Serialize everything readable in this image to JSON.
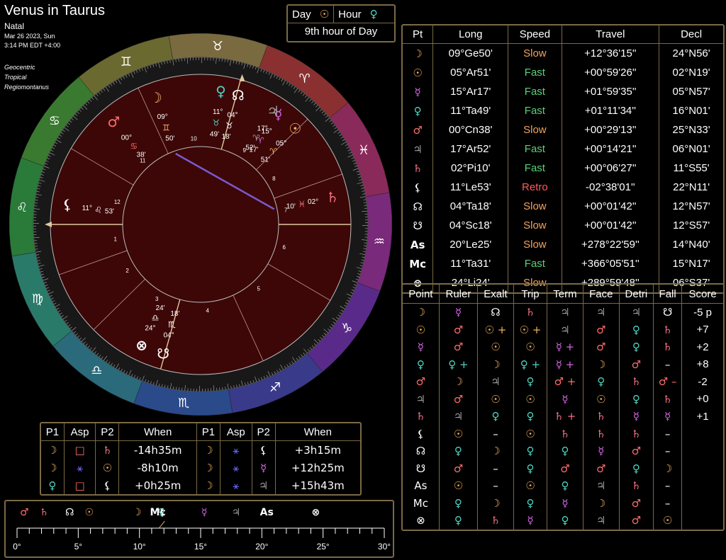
{
  "header": {
    "title": "Venus in Taurus",
    "subtitle": "Natal",
    "date": "Mar 26 2023, Sun",
    "time": "3:14 PM EDT +4:00",
    "settings": [
      "Geocentric",
      "Tropical",
      "Regiomontanus"
    ]
  },
  "day_hour": {
    "day_label": "Day",
    "day_symbol": "☉",
    "hour_label": "Hour",
    "hour_symbol": "♀",
    "hour_text": "9th hour of Day"
  },
  "colors": {
    "border": "#7a6a45",
    "wheel_fill": "#3d0707",
    "moon": "#f0b060",
    "sun": "#f0b060",
    "mercury": "#d667e6",
    "venus": "#4fd4c0",
    "mars": "#ff6d6d",
    "jupiter": "#9a9a9a",
    "saturn": "#f07080",
    "white": "#ffffff",
    "slow": "#f5a25a",
    "fast": "#5bd17a",
    "retro": "#ff5a5a"
  },
  "positions": {
    "headers": [
      "Pt",
      "Long",
      "Speed",
      "Travel",
      "Decl"
    ],
    "rows": [
      {
        "sym": "☽",
        "color": "#f0b060",
        "long": "09°Ge50'",
        "speed": "Slow",
        "travel": "+12°36'15''",
        "decl": "24°N56'"
      },
      {
        "sym": "☉",
        "color": "#f0b060",
        "long": "05°Ar51'",
        "speed": "Fast",
        "travel": "+00°59'26''",
        "decl": "02°N19'"
      },
      {
        "sym": "☿",
        "color": "#d667e6",
        "long": "15°Ar17'",
        "speed": "Fast",
        "travel": "+01°59'35''",
        "decl": "05°N57'"
      },
      {
        "sym": "♀",
        "color": "#4fd4c0",
        "long": "11°Ta49'",
        "speed": "Fast",
        "travel": "+01°11'34''",
        "decl": "16°N01'"
      },
      {
        "sym": "♂",
        "color": "#ff6d6d",
        "long": "00°Cn38'",
        "speed": "Slow",
        "travel": "+00°29'13''",
        "decl": "25°N33'"
      },
      {
        "sym": "♃",
        "color": "#9a9a9a",
        "long": "17°Ar52'",
        "speed": "Fast",
        "travel": "+00°14'21''",
        "decl": "06°N01'"
      },
      {
        "sym": "♄",
        "color": "#f07080",
        "long": "02°Pi10'",
        "speed": "Fast",
        "travel": "+00°06'27''",
        "decl": "11°S55'"
      },
      {
        "sym": "⚸",
        "color": "#ffffff",
        "long": "11°Le53'",
        "speed": "Retro",
        "travel": "-02°38'01''",
        "decl": "22°N11'"
      },
      {
        "sym": "☊",
        "color": "#ffffff",
        "long": "04°Ta18'",
        "speed": "Slow",
        "travel": "+00°01'42''",
        "decl": "12°N57'"
      },
      {
        "sym": "☋",
        "color": "#ffffff",
        "long": "04°Sc18'",
        "speed": "Slow",
        "travel": "+00°01'42''",
        "decl": "12°S57'"
      },
      {
        "sym": "As",
        "color": "#ffffff",
        "long": "20°Le25'",
        "speed": "Slow",
        "travel": "+278°22'59''",
        "decl": "14°N40'"
      },
      {
        "sym": "Mc",
        "color": "#ffffff",
        "long": "11°Ta31'",
        "speed": "Fast",
        "travel": "+366°05'51''",
        "decl": "15°N17'"
      },
      {
        "sym": "⊗",
        "color": "#ffffff",
        "long": "24°Li24'",
        "speed": "Slow",
        "travel": "+289°59'48''",
        "decl": "06°S37'"
      }
    ]
  },
  "dignities": {
    "headers": [
      "Point",
      "Ruler",
      "Exalt",
      "Trip",
      "Term",
      "Face",
      "Detri",
      "Fall",
      "Score"
    ],
    "rows": [
      {
        "cells": [
          "☽",
          "☿",
          "☊",
          "♄",
          "♃",
          "♃",
          "♃",
          "☋"
        ],
        "colors": [
          "#f0b060",
          "#d667e6",
          "#fff",
          "#f07080",
          "#9a9a9a",
          "#9a9a9a",
          "#9a9a9a",
          "#fff"
        ],
        "score": "-5 p"
      },
      {
        "cells": [
          "☉",
          "♂",
          "☉ +",
          "☉ +",
          "♃",
          "♂",
          "♀",
          "♄"
        ],
        "colors": [
          "#f0b060",
          "#ff6d6d",
          "#f0b060",
          "#f0b060",
          "#9a9a9a",
          "#ff6d6d",
          "#4fd4c0",
          "#f07080"
        ],
        "score": "+7"
      },
      {
        "cells": [
          "☿",
          "♂",
          "☉",
          "☉",
          "☿ +",
          "♂",
          "♀",
          "♄"
        ],
        "colors": [
          "#d667e6",
          "#ff6d6d",
          "#f0b060",
          "#f0b060",
          "#d667e6",
          "#ff6d6d",
          "#4fd4c0",
          "#f07080"
        ],
        "score": "+2"
      },
      {
        "cells": [
          "♀",
          "♀ +",
          "☽",
          "♀ +",
          "☿ +",
          "☽",
          "♂",
          "–"
        ],
        "colors": [
          "#4fd4c0",
          "#4fd4c0",
          "#f0b060",
          "#4fd4c0",
          "#d667e6",
          "#f0b060",
          "#ff6d6d",
          "#fff"
        ],
        "score": "+8"
      },
      {
        "cells": [
          "♂",
          "☽",
          "♃",
          "♀",
          "♂ +",
          "♀",
          "♄",
          "♂ –"
        ],
        "colors": [
          "#ff6d6d",
          "#f0b060",
          "#9a9a9a",
          "#4fd4c0",
          "#ff6d6d",
          "#4fd4c0",
          "#f07080",
          "#ff6d6d"
        ],
        "score": "-2"
      },
      {
        "cells": [
          "♃",
          "♂",
          "☉",
          "☉",
          "☿",
          "☉",
          "♀",
          "♄"
        ],
        "colors": [
          "#9a9a9a",
          "#ff6d6d",
          "#f0b060",
          "#f0b060",
          "#d667e6",
          "#f0b060",
          "#4fd4c0",
          "#f07080"
        ],
        "score": "+0"
      },
      {
        "cells": [
          "♄",
          "♃",
          "♀",
          "♀",
          "♄ +",
          "♄",
          "☿",
          "☿"
        ],
        "colors": [
          "#f07080",
          "#9a9a9a",
          "#4fd4c0",
          "#4fd4c0",
          "#f07080",
          "#f07080",
          "#d667e6",
          "#d667e6"
        ],
        "score": "+1"
      },
      {
        "cells": [
          "⚸",
          "☉",
          "–",
          "☉",
          "♄",
          "♄",
          "♄",
          "–"
        ],
        "colors": [
          "#fff",
          "#f0b060",
          "#fff",
          "#f0b060",
          "#f07080",
          "#f07080",
          "#f07080",
          "#fff"
        ],
        "score": ""
      },
      {
        "cells": [
          "☊",
          "♀",
          "☽",
          "♀",
          "♀",
          "☿",
          "♂",
          "–"
        ],
        "colors": [
          "#fff",
          "#4fd4c0",
          "#f0b060",
          "#4fd4c0",
          "#4fd4c0",
          "#d667e6",
          "#ff6d6d",
          "#fff"
        ],
        "score": ""
      },
      {
        "cells": [
          "☋",
          "♂",
          "–",
          "♀",
          "♂",
          "♂",
          "♀",
          "☽"
        ],
        "colors": [
          "#fff",
          "#ff6d6d",
          "#fff",
          "#4fd4c0",
          "#ff6d6d",
          "#ff6d6d",
          "#4fd4c0",
          "#f0b060"
        ],
        "score": ""
      },
      {
        "cells": [
          "As",
          "☉",
          "–",
          "☉",
          "♀",
          "♃",
          "♄",
          "–"
        ],
        "colors": [
          "#fff",
          "#f0b060",
          "#fff",
          "#f0b060",
          "#4fd4c0",
          "#9a9a9a",
          "#f07080",
          "#fff"
        ],
        "score": ""
      },
      {
        "cells": [
          "Mc",
          "♀",
          "☽",
          "♀",
          "☿",
          "☽",
          "♂",
          "–"
        ],
        "colors": [
          "#fff",
          "#4fd4c0",
          "#f0b060",
          "#4fd4c0",
          "#d667e6",
          "#f0b060",
          "#ff6d6d",
          "#fff"
        ],
        "score": ""
      },
      {
        "cells": [
          "⊗",
          "♀",
          "♄",
          "☿",
          "♀",
          "♃",
          "♂",
          "☉"
        ],
        "colors": [
          "#fff",
          "#4fd4c0",
          "#f07080",
          "#d667e6",
          "#4fd4c0",
          "#9a9a9a",
          "#ff6d6d",
          "#f0b060"
        ],
        "score": ""
      }
    ]
  },
  "aspects": {
    "headers": [
      "P1",
      "Asp",
      "P2",
      "When",
      "P1",
      "Asp",
      "P2",
      "When"
    ],
    "rows": [
      [
        {
          "s": "☽",
          "c": "#f0b060"
        },
        {
          "s": "□",
          "c": "#ff6d6d"
        },
        {
          "s": "♄",
          "c": "#f07080"
        },
        {
          "s": "-14h35m",
          "c": "#fff"
        },
        {
          "s": "☽",
          "c": "#f0b060"
        },
        {
          "s": "⚹",
          "c": "#6a6aff"
        },
        {
          "s": "⚸",
          "c": "#fff"
        },
        {
          "s": "+3h15m",
          "c": "#fff"
        }
      ],
      [
        {
          "s": "☽",
          "c": "#f0b060"
        },
        {
          "s": "⚹",
          "c": "#6a6aff"
        },
        {
          "s": "☉",
          "c": "#f0b060"
        },
        {
          "s": "-8h10m",
          "c": "#fff"
        },
        {
          "s": "☽",
          "c": "#f0b060"
        },
        {
          "s": "⚹",
          "c": "#6a6aff"
        },
        {
          "s": "☿",
          "c": "#d667e6"
        },
        {
          "s": "+12h25m",
          "c": "#fff"
        }
      ],
      [
        {
          "s": "♀",
          "c": "#4fd4c0"
        },
        {
          "s": "□",
          "c": "#ff6d6d"
        },
        {
          "s": "⚸",
          "c": "#fff"
        },
        {
          "s": "+0h25m",
          "c": "#fff"
        },
        {
          "s": "☽",
          "c": "#f0b060"
        },
        {
          "s": "⚹",
          "c": "#6a6aff"
        },
        {
          "s": "♃",
          "c": "#9a9a9a"
        },
        {
          "s": "+15h43m",
          "c": "#fff"
        }
      ]
    ]
  },
  "ruler": {
    "tick_labels": [
      "0°",
      "5°",
      "10°",
      "15°",
      "20°",
      "25°",
      "30°"
    ],
    "markers": [
      {
        "sym": "♂",
        "deg": 0.6,
        "color": "#ff6d6d"
      },
      {
        "sym": "♄",
        "deg": 2.2,
        "color": "#f07080"
      },
      {
        "sym": "☊",
        "deg": 4.3,
        "color": "#fff"
      },
      {
        "sym": "☉",
        "deg": 5.9,
        "color": "#f0b060"
      },
      {
        "sym": "☽",
        "deg": 9.8,
        "color": "#f0b060"
      },
      {
        "sym": "Mc",
        "deg": 11.5,
        "color": "#fff"
      },
      {
        "sym": "♀",
        "deg": 11.8,
        "color": "#4fd4c0"
      },
      {
        "sym": "⚸",
        "deg": 11.9,
        "color": "#fff"
      },
      {
        "sym": "☿",
        "deg": 15.3,
        "color": "#d667e6"
      },
      {
        "sym": "♃",
        "deg": 17.9,
        "color": "#9a9a9a"
      },
      {
        "sym": "As",
        "deg": 20.4,
        "color": "#fff"
      },
      {
        "sym": "⊗",
        "deg": 24.4,
        "color": "#fff"
      }
    ]
  },
  "wheel": {
    "asc_deg": 140.42,
    "signs": [
      "♈",
      "♉",
      "♊",
      "♋",
      "♌",
      "♍",
      "♎",
      "♏",
      "♐",
      "♑",
      "♒",
      "♓"
    ],
    "sign_colors": [
      "#8a3030",
      "#7a6a40",
      "#6a6a30",
      "#3a7a30",
      "#2a7a3a",
      "#2a7a6a",
      "#2a6a7a",
      "#2a4a8a",
      "#3a3a8a",
      "#5a2a8a",
      "#7a2a7a",
      "#8a2a5a"
    ],
    "cusps_deg": [
      140.42,
      160,
      185,
      215,
      255,
      290,
      320.42,
      340,
      5,
      35,
      75,
      110
    ],
    "house_numbers": [
      "1",
      "2",
      "3",
      "4",
      "5",
      "6",
      "7",
      "8",
      "9",
      "10",
      "11",
      "12"
    ],
    "planets": [
      {
        "sym": "☽",
        "deg": 69.83,
        "color": "#f0b060",
        "label": "09°",
        "sign": "♊",
        "min": "50'"
      },
      {
        "sym": "☉",
        "deg": 5.85,
        "color": "#f0b060",
        "label": "05°",
        "sign": "♈",
        "min": "51'"
      },
      {
        "sym": "☿",
        "deg": 15.28,
        "color": "#d667e6",
        "label": "15°",
        "sign": "♈",
        "min": "17'"
      },
      {
        "sym": "♀",
        "deg": 41.82,
        "color": "#4fd4c0",
        "label": "11°",
        "sign": "♉",
        "min": "49'"
      },
      {
        "sym": "♂",
        "deg": 90.63,
        "color": "#ff6d6d",
        "label": "00°",
        "sign": "♋",
        "min": "38'"
      },
      {
        "sym": "♃",
        "deg": 17.87,
        "color": "#9a9a9a",
        "label": "17°",
        "sign": "♈",
        "min": "52'"
      },
      {
        "sym": "♄",
        "deg": 332.17,
        "color": "#f07080",
        "label": "02°",
        "sign": "♓",
        "min": "10'"
      },
      {
        "sym": "⚸",
        "deg": 131.88,
        "color": "#ffffff",
        "label": "11°",
        "sign": "♌",
        "min": "53'"
      },
      {
        "sym": "☊",
        "deg": 34.3,
        "color": "#ffffff",
        "label": "04°",
        "sign": "♉",
        "min": "18'"
      },
      {
        "sym": "☋",
        "deg": 214.3,
        "color": "#ffffff",
        "label": "04°",
        "sign": "♏",
        "min": "18'"
      },
      {
        "sym": "⊗",
        "deg": 204.4,
        "color": "#ffffff",
        "label": "24°",
        "sign": "♎",
        "min": "24'"
      }
    ]
  }
}
